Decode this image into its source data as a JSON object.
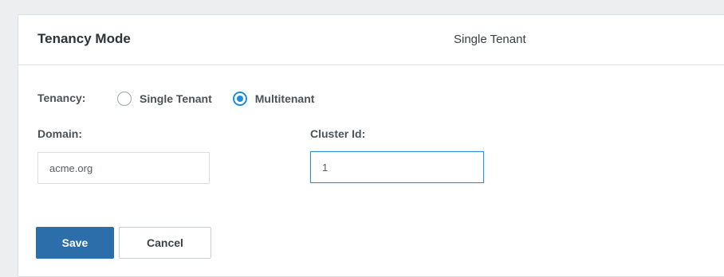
{
  "header": {
    "title": "Tenancy Mode",
    "current_mode": "Single Tenant"
  },
  "form": {
    "tenancy_label": "Tenancy:",
    "options": [
      {
        "label": "Single Tenant",
        "selected": false
      },
      {
        "label": "Multitenant",
        "selected": true
      }
    ],
    "domain_label": "Domain:",
    "domain_value": "acme.org",
    "cluster_label": "Cluster Id:",
    "cluster_value": "1"
  },
  "actions": {
    "save_label": "Save",
    "cancel_label": "Cancel"
  },
  "colors": {
    "accent": "#1d8ce0",
    "primary_button": "#2b6ea9",
    "focus_border": "#2f8fd8"
  }
}
